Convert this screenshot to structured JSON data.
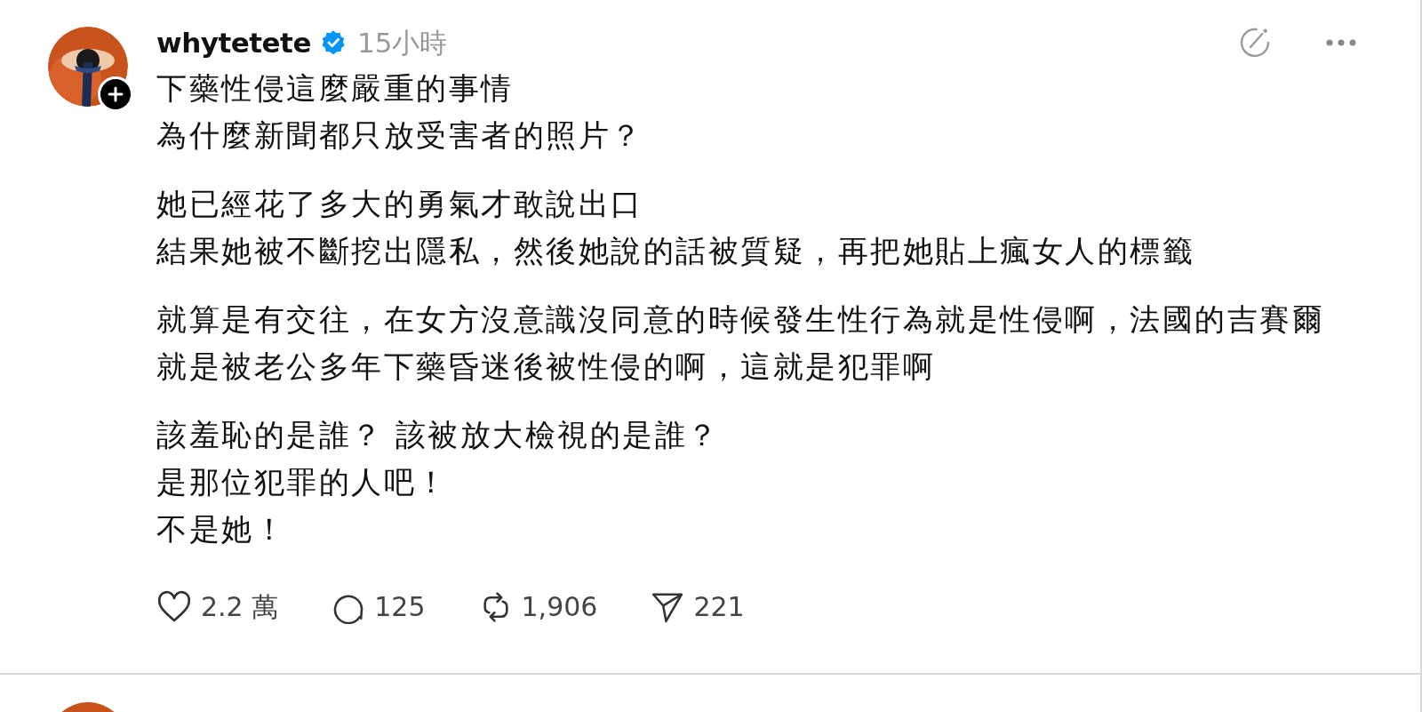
{
  "post": {
    "author": "whytetete",
    "verified": true,
    "time": "15小時",
    "paragraphs": [
      [
        "下藥性侵這麼嚴重的事情",
        "為什麼新聞都只放受害者的照片？"
      ],
      [
        "她已經花了多大的勇氣才敢說出口",
        "結果她被不斷挖出隱私，然後她說的話被質疑，再把她貼上瘋女人的標籤"
      ],
      [
        "就算是有交往，在女方沒意識沒同意的時候發生性行為就是性侵啊，法國的吉賽爾",
        "就是被老公多年下藥昏迷後被性侵的啊，這就是犯罪啊"
      ],
      [
        "該羞恥的是誰？ 該被放大檢視的是誰？",
        "是那位犯罪的人吧！",
        "不是她！"
      ]
    ],
    "actions": [
      {
        "kind": "like",
        "count": "2.2 萬"
      },
      {
        "kind": "comment",
        "count": "125"
      },
      {
        "kind": "repost",
        "count": "1,906"
      },
      {
        "kind": "share",
        "count": "221"
      }
    ]
  }
}
